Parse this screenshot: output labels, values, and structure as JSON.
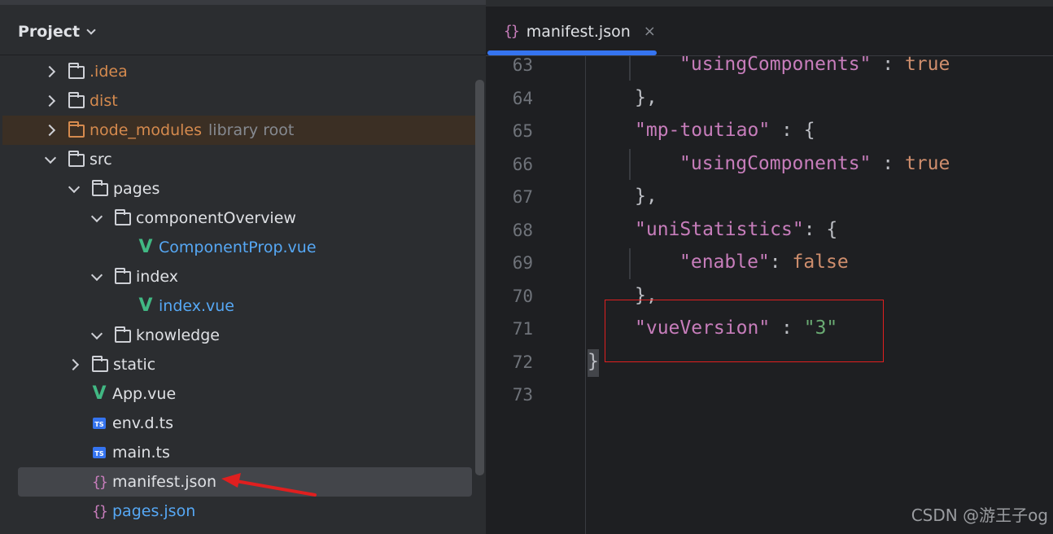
{
  "panel": {
    "title": "Project"
  },
  "tree": [
    {
      "label": ".idea",
      "type": "folder",
      "expand": "collapsed"
    },
    {
      "label": "dist",
      "type": "folder",
      "expand": "collapsed"
    },
    {
      "label": "node_modules",
      "type": "folder",
      "expand": "collapsed",
      "note": "library root"
    },
    {
      "label": "src",
      "type": "folder",
      "expand": "expanded"
    },
    {
      "label": "pages",
      "type": "folder",
      "expand": "expanded"
    },
    {
      "label": "componentOverview",
      "type": "folder",
      "expand": "expanded"
    },
    {
      "label": "ComponentProp.vue",
      "type": "vue-file"
    },
    {
      "label": "index",
      "type": "folder",
      "expand": "expanded"
    },
    {
      "label": "index.vue",
      "type": "vue-file"
    },
    {
      "label": "knowledge",
      "type": "folder",
      "expand": "expanded"
    },
    {
      "label": "static",
      "type": "folder",
      "expand": "collapsed"
    },
    {
      "label": "App.vue",
      "type": "vue-file"
    },
    {
      "label": "env.d.ts",
      "type": "ts-file",
      "icon_text": "TS"
    },
    {
      "label": "main.ts",
      "type": "ts-file",
      "icon_text": "TS"
    },
    {
      "label": "manifest.json",
      "type": "json-file",
      "icon_text": "{}"
    },
    {
      "label": "pages.json",
      "type": "json-file",
      "icon_text": "{}"
    }
  ],
  "editor": {
    "tab": {
      "icon_text": "{}",
      "label": "manifest.json",
      "close": "×"
    },
    "line_numbers": [
      "63",
      "64",
      "65",
      "66",
      "67",
      "68",
      "69",
      "70",
      "71",
      "72",
      "73"
    ],
    "code": {
      "l63_key": "\"usingComponents\"",
      "l63_sep": " : ",
      "l63_val": "true",
      "l64": "},",
      "l65_key": "\"mp-toutiao\"",
      "l65_sep": " : {",
      "l66_key": "\"usingComponents\"",
      "l66_sep": " : ",
      "l66_val": "true",
      "l67": "},",
      "l68_key": "\"uniStatistics\"",
      "l68_sep": ": {",
      "l69_key": "\"enable\"",
      "l69_sep": ": ",
      "l69_val": "false",
      "l70": "},",
      "l71_key": "\"vueVersion\"",
      "l71_sep": " : ",
      "l71_val": "\"3\"",
      "l72": "}"
    }
  },
  "watermark": "CSDN @游王子og",
  "colors": {
    "panel_bg": "#2b2d30",
    "editor_bg": "#1e1f22",
    "string_key": "#c77dbb",
    "string_value": "#6aab73",
    "keyword": "#cf8e6d",
    "accent": "#3574f0",
    "vue_green": "#41b883",
    "annotation_red": "#e01f1f"
  }
}
